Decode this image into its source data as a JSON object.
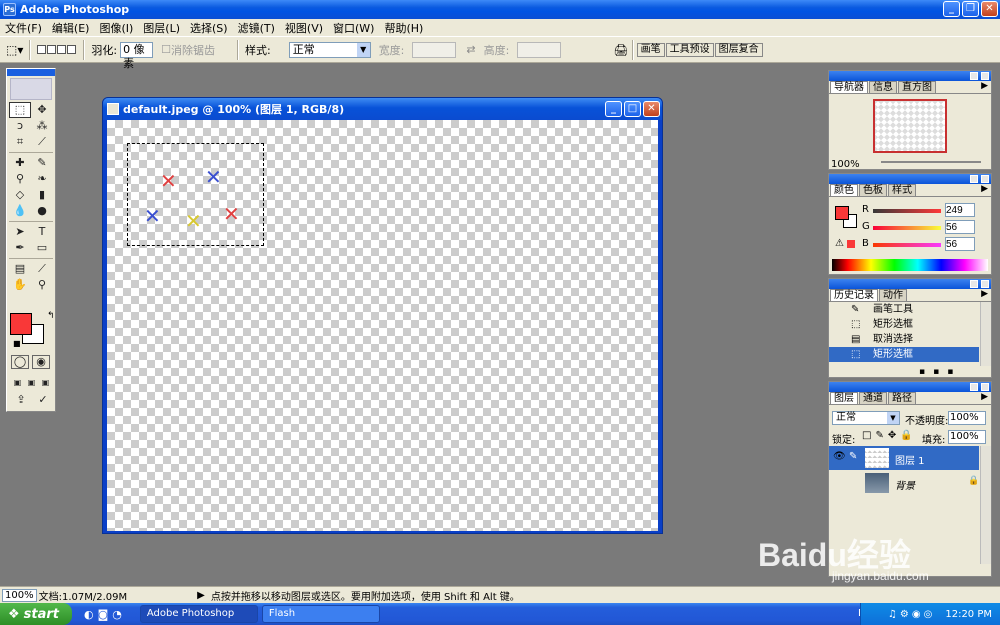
{
  "window": {
    "title": "Adobe Photoshop"
  },
  "menu": [
    "文件(F)",
    "编辑(E)",
    "图像(I)",
    "图层(L)",
    "选择(S)",
    "滤镜(T)",
    "视图(V)",
    "窗口(W)",
    "帮助(H)"
  ],
  "options": {
    "feather_label": "羽化:",
    "feather_value": "0 像素",
    "antialias_label": "消除锯齿",
    "style_label": "样式:",
    "style_value": "正常",
    "width_label": "宽度:",
    "height_label": "高度:",
    "tabs": [
      "画笔",
      "工具预设",
      "图层复合"
    ]
  },
  "document": {
    "title": "default.jpeg @ 100% (图层 1, RGB/8)",
    "marks": [
      {
        "glyph": "✕",
        "color": "#e04040"
      },
      {
        "glyph": "✕",
        "color": "#3a4fd0"
      },
      {
        "glyph": "✕",
        "color": "#3a4fd0"
      },
      {
        "glyph": "✕",
        "color": "#d8c830"
      },
      {
        "glyph": "✕",
        "color": "#e04040"
      }
    ]
  },
  "navigator": {
    "tabs": [
      "导航器",
      "信息",
      "直方图"
    ],
    "zoom": "100%"
  },
  "color": {
    "tabs": [
      "颜色",
      "色板",
      "样式"
    ],
    "r_label": "R",
    "r_value": "249",
    "g_label": "G",
    "g_value": "56",
    "b_label": "B",
    "b_value": "56",
    "fg_color": "#f93838"
  },
  "history": {
    "tabs": [
      "历史记录",
      "动作"
    ],
    "items": [
      "画笔工具",
      "矩形选框",
      "取消选择",
      "矩形选框"
    ]
  },
  "layers": {
    "tabs": [
      "图层",
      "通道",
      "路径"
    ],
    "blend_mode": "正常",
    "opacity_label": "不透明度:",
    "opacity_value": "100%",
    "lock_label": "锁定:",
    "fill_label": "填充:",
    "fill_value": "100%",
    "rows": [
      {
        "name": "图层 1",
        "selected": true
      },
      {
        "name": "背景",
        "selected": false
      }
    ]
  },
  "status": {
    "zoom": "100%",
    "doc_size": "文档:1.07M/2.09M",
    "hint": "点按并拖移以移动图层或选区。要用附加选项，使用 Shift 和 Alt 键。"
  },
  "watermark": {
    "text": "Baidu经验",
    "url": "jingyan.baidu.com"
  },
  "taskbar": {
    "start": "start",
    "tasks": [
      "Adobe Photoshop",
      "Flash"
    ],
    "lang": "EN",
    "clock": "12:20 PM"
  }
}
